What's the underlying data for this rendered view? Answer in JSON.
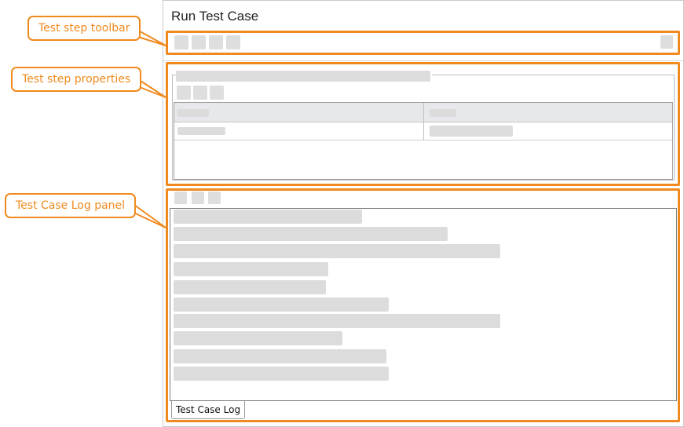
{
  "window": {
    "title": "Run Test Case"
  },
  "callouts": {
    "toolbar": "Test step toolbar",
    "properties": "Test step properties",
    "log_panel": "Test Case Log panel"
  },
  "log_panel": {
    "tab_label": "Test Case Log"
  },
  "colors": {
    "highlight": "#f08a1e",
    "placeholder": "#dcdcdc"
  }
}
